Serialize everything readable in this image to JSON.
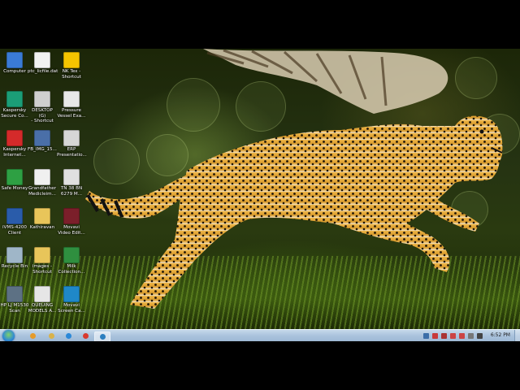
{
  "desktop_icons": [
    {
      "label": "Computer",
      "icon": "computer-icon",
      "color": "#3a7bd5"
    },
    {
      "label": "ptc_licfile.dat",
      "icon": "file-icon",
      "color": "#f2f2f2"
    },
    {
      "label": "NK Tex -\nShortcut",
      "icon": "warning-icon",
      "color": "#f5c400"
    },
    {
      "label": "Kaspersky\nSecure Co...",
      "icon": "kaspersky-shield-icon",
      "color": "#1b9e77"
    },
    {
      "label": "DESKTOP (G)\n- Shortcut",
      "icon": "drive-icon",
      "color": "#cfcfcf"
    },
    {
      "label": "Pressure\nVessel Exa...",
      "icon": "pdf-icon",
      "color": "#e8e8e8"
    },
    {
      "label": "Kaspersky\nInternet...",
      "icon": "kaspersky-k-icon",
      "color": "#d42a2a"
    },
    {
      "label": "FB_IMG_15...",
      "icon": "image-icon",
      "color": "#4a6fa8"
    },
    {
      "label": "ERP\nPresentatio...",
      "icon": "presentation-icon",
      "color": "#d6d6d6"
    },
    {
      "label": "Safe Money",
      "icon": "money-icon",
      "color": "#2ea043"
    },
    {
      "label": "Grandfather\nMedicleim...",
      "icon": "document-icon",
      "color": "#f0f0f0"
    },
    {
      "label": "TN 38 BN\n6279 M...",
      "icon": "document-icon",
      "color": "#e0e0e0"
    },
    {
      "label": "iVMS-4200\nClient",
      "icon": "camera-client-icon",
      "color": "#2a5caa"
    },
    {
      "label": "Kathiravan",
      "icon": "folder-icon",
      "color": "#e8c55a"
    },
    {
      "label": "Movavi\nVideo Edit...",
      "icon": "movavi-video-icon",
      "color": "#7b1f2a"
    },
    {
      "label": "Recycle Bin",
      "icon": "recycle-bin-icon",
      "color": "#9fb6c8"
    },
    {
      "label": "images -\nShortcut",
      "icon": "folder-shortcut-icon",
      "color": "#e8c55a"
    },
    {
      "label": "Milk\nCollection...",
      "icon": "excel-icon",
      "color": "#2f8f3f"
    },
    {
      "label": "HP LJ M1530\nScan",
      "icon": "scanner-icon",
      "color": "#5d7184"
    },
    {
      "label": "QUEUING\nMODELS A...",
      "icon": "document-icon",
      "color": "#e6e6e6"
    },
    {
      "label": "Movavi\nScreen Ca...",
      "icon": "movavi-screen-icon",
      "color": "#1f88c8"
    }
  ],
  "taskbar": {
    "pinned": [
      {
        "icon": "ie-icon",
        "color": "#e59b2a"
      },
      {
        "icon": "explorer-folder-icon",
        "color": "#d9b24a"
      },
      {
        "icon": "media-player-icon",
        "color": "#2b88d8"
      },
      {
        "icon": "chrome-icon",
        "color": "#d93a2f"
      },
      {
        "icon": "monitor-app-icon",
        "color": "#2d7fbf"
      }
    ],
    "tray": [
      {
        "icon": "tray-app-icon",
        "color": "#3b6ea8"
      },
      {
        "icon": "tray-kaspersky-icon",
        "color": "#c83a3a"
      },
      {
        "icon": "tray-app-icon",
        "color": "#a33"
      },
      {
        "icon": "tray-app-icon",
        "color": "#c44"
      },
      {
        "icon": "tray-app-icon",
        "color": "#c44"
      },
      {
        "icon": "tray-app-icon",
        "color": "#777"
      },
      {
        "icon": "volume-icon",
        "color": "#444"
      }
    ],
    "clock": "6:52 PM"
  },
  "colors": {
    "taskbar_top": "#c6d8ea",
    "taskbar_bottom": "#9db8d4",
    "wallpaper_dark": "#1c2608"
  }
}
